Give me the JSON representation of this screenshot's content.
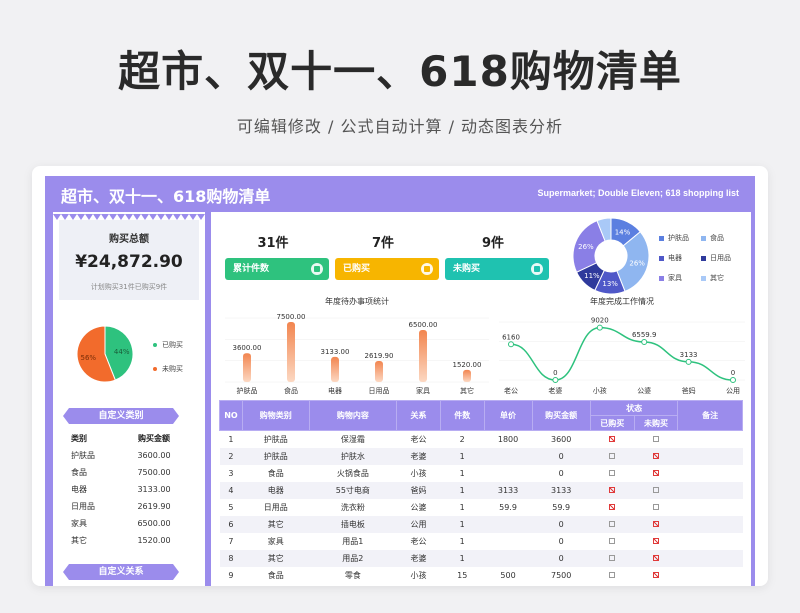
{
  "hero": {
    "title": "超市、双十一、618购物清单",
    "subtitle": "可编辑修改 / 公式自动计算 / 动态图表分析"
  },
  "sheet": {
    "title": "超市、双十一、618购物清单",
    "title_en": "Supermarket; Double Eleven; 618 shopping list"
  },
  "summary": {
    "label": "购买总额",
    "value": "¥24,872.90",
    "note": "计划购买31件已购买9件"
  },
  "status_pie": {
    "legend": [
      "已购买",
      "未购买"
    ],
    "labels": [
      "44%",
      "56%"
    ],
    "values": [
      44,
      56
    ],
    "colors": [
      "#2ec27e",
      "#f26b2c"
    ]
  },
  "category_section": {
    "ribbon": "自定义类别",
    "headers": [
      "类别",
      "购买金额"
    ],
    "rows": [
      [
        "护肤品",
        "3600.00"
      ],
      [
        "食品",
        "7500.00"
      ],
      [
        "电器",
        "3133.00"
      ],
      [
        "日用品",
        "2619.90"
      ],
      [
        "家具",
        "6500.00"
      ],
      [
        "其它",
        "1520.00"
      ]
    ],
    "ribbon2": "自定义关系"
  },
  "stats": [
    {
      "num": "31件",
      "label": "累计件数",
      "color": "#2ec27e"
    },
    {
      "num": "7件",
      "label": "已购买",
      "color": "#f7b500"
    },
    {
      "num": "9件",
      "label": "未购买",
      "color": "#1fc2b0"
    }
  ],
  "donut": {
    "labels": [
      "14%",
      "26%",
      "26%",
      "11%",
      "13%"
    ],
    "legend": [
      "护肤品",
      "食品",
      "电器",
      "日用品",
      "家具",
      "其它"
    ],
    "colors": [
      "#5b7fe0",
      "#8fb6f0",
      "#4f58c8",
      "#2f3a9c",
      "#8a7fe6",
      "#a9c9f7"
    ],
    "values": [
      14,
      30,
      13,
      11,
      26,
      6
    ]
  },
  "chart_data": [
    {
      "type": "bar",
      "title": "年度待办事项统计",
      "categories": [
        "护肤品",
        "食品",
        "电器",
        "日用品",
        "家具",
        "其它"
      ],
      "values": [
        3600,
        7500,
        3133,
        2619.9,
        6500,
        1520
      ],
      "value_labels": [
        "3600.00",
        "7500.00",
        "3133.00",
        "2619.90",
        "6500.00",
        "1520.00"
      ],
      "ylim": [
        0,
        8000
      ]
    },
    {
      "type": "line",
      "title": "年度完成工作情况",
      "categories": [
        "老公",
        "老婆",
        "小孩",
        "公婆",
        "爸妈",
        "公用"
      ],
      "values": [
        6160,
        0,
        9020,
        6559.9,
        3133,
        0
      ],
      "value_labels": [
        "6160",
        "0",
        "9020",
        "6559.9",
        "3133",
        "0"
      ],
      "ylim": [
        0,
        10000
      ]
    }
  ],
  "table": {
    "headers": [
      "NO",
      "购物类别",
      "购物内容",
      "关系",
      "件数",
      "单价",
      "购买金额",
      "状态",
      "备注"
    ],
    "sub_headers": [
      "已购买",
      "未购买"
    ],
    "rows": [
      [
        "1",
        "护肤品",
        "保湿霜",
        "老公",
        "2",
        "1800",
        "3600",
        true,
        false
      ],
      [
        "2",
        "护肤品",
        "护肤水",
        "老婆",
        "1",
        "",
        "0",
        false,
        true
      ],
      [
        "3",
        "食品",
        "火锅食品",
        "小孩",
        "1",
        "",
        "0",
        false,
        true
      ],
      [
        "4",
        "电器",
        "55寸电商",
        "爸妈",
        "1",
        "3133",
        "3133",
        true,
        false
      ],
      [
        "5",
        "日用品",
        "洗衣粉",
        "公婆",
        "1",
        "59.9",
        "59.9",
        true,
        false
      ],
      [
        "6",
        "其它",
        "插电板",
        "公用",
        "1",
        "",
        "0",
        false,
        true
      ],
      [
        "7",
        "家具",
        "用品1",
        "老公",
        "1",
        "",
        "0",
        false,
        true
      ],
      [
        "8",
        "其它",
        "用品2",
        "老婆",
        "1",
        "",
        "0",
        false,
        true
      ],
      [
        "9",
        "食品",
        "零食",
        "小孩",
        "15",
        "500",
        "7500",
        false,
        true
      ]
    ]
  }
}
